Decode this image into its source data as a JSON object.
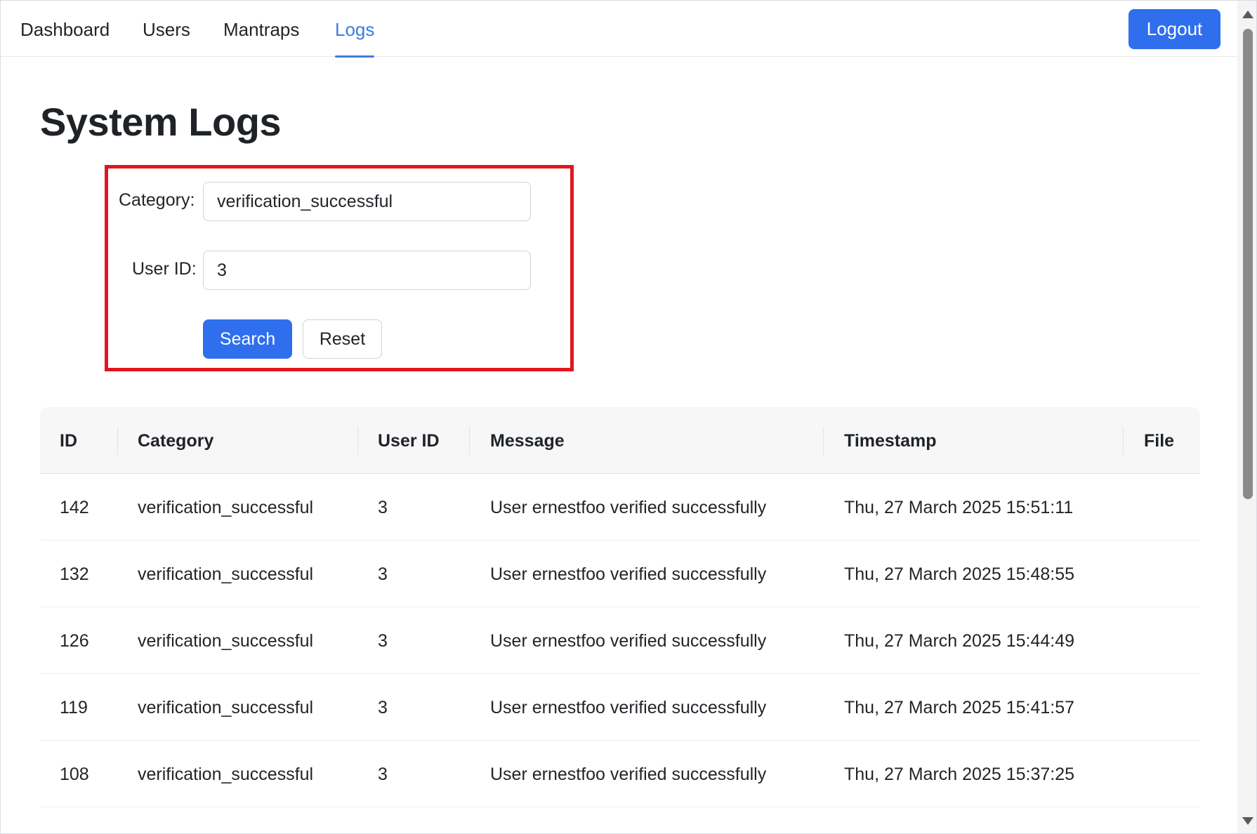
{
  "nav": {
    "items": [
      {
        "label": "Dashboard",
        "active": false
      },
      {
        "label": "Users",
        "active": false
      },
      {
        "label": "Mantraps",
        "active": false
      },
      {
        "label": "Logs",
        "active": true
      }
    ],
    "logout_label": "Logout",
    "active_color": "#3b7ddd"
  },
  "page": {
    "title": "System Logs"
  },
  "filters": {
    "category_label": "Category:",
    "category_value": "verification_successful",
    "user_id_label": "User ID:",
    "user_id_value": "3",
    "search_label": "Search",
    "reset_label": "Reset",
    "highlight_color": "#e0171f"
  },
  "table": {
    "headers": [
      "ID",
      "Category",
      "User ID",
      "Message",
      "Timestamp",
      "File"
    ],
    "rows": [
      {
        "id": "142",
        "category": "verification_successful",
        "user_id": "3",
        "message": "User ernestfoo verified successfully",
        "timestamp": "Thu, 27 March 2025 15:51:11",
        "file": ""
      },
      {
        "id": "132",
        "category": "verification_successful",
        "user_id": "3",
        "message": "User ernestfoo verified successfully",
        "timestamp": "Thu, 27 March 2025 15:48:55",
        "file": ""
      },
      {
        "id": "126",
        "category": "verification_successful",
        "user_id": "3",
        "message": "User ernestfoo verified successfully",
        "timestamp": "Thu, 27 March 2025 15:44:49",
        "file": ""
      },
      {
        "id": "119",
        "category": "verification_successful",
        "user_id": "3",
        "message": "User ernestfoo verified successfully",
        "timestamp": "Thu, 27 March 2025 15:41:57",
        "file": ""
      },
      {
        "id": "108",
        "category": "verification_successful",
        "user_id": "3",
        "message": "User ernestfoo verified successfully",
        "timestamp": "Thu, 27 March 2025 15:37:25",
        "file": ""
      }
    ]
  },
  "colors": {
    "primary_button": "#2f6fed"
  }
}
